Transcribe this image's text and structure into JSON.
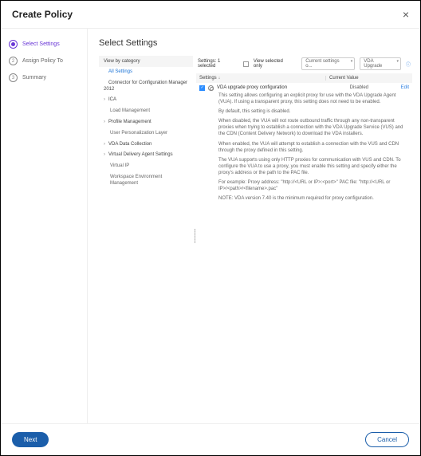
{
  "header": {
    "title": "Create Policy"
  },
  "steps": [
    {
      "label": "Select Settings"
    },
    {
      "label": "Assign Policy To"
    },
    {
      "label": "Summary"
    }
  ],
  "panel": {
    "title": "Select Settings"
  },
  "categories": {
    "header": "View by category",
    "items": [
      {
        "label": "All Settings"
      },
      {
        "label": "Connector for Configuration Manager 2012"
      },
      {
        "label": "ICA"
      },
      {
        "label": "Load Management"
      },
      {
        "label": "Profile Management"
      },
      {
        "label": "User Personalization Layer"
      },
      {
        "label": "VDA Data Collection"
      },
      {
        "label": "Virtual Delivery Agent Settings"
      },
      {
        "label": "Virtual IP"
      },
      {
        "label": "Workspace Environment Management"
      }
    ]
  },
  "toolbar": {
    "selected_text": "Settings: 1 selected",
    "view_selected_label": "View selected only",
    "version_filter": "Current settings o...",
    "vda_filter": "VDA Upgrade"
  },
  "table": {
    "col_settings": "Settings",
    "col_value": "Current Value",
    "rows": [
      {
        "name": "VDA upgrade proxy configuration",
        "value": "Disabled",
        "edit_label": "Edit",
        "desc": [
          "This setting allows configuring an explicit proxy for use with the VDA Upgrade Agent (VUA). If using a transparent proxy, this setting does not need to be enabled.",
          "By default, this setting is disabled.",
          "When disabled, the VUA will not route outbound traffic through any non-transparent proxies when trying to establish a connection with the VDA Upgrade Service (VUS) and the CDN (Content Delivery Network) to download the VDA installers.",
          "When enabled, the VUA will attempt to establish a connection with the VUS and CDN through the proxy defined in this setting.",
          "The VUA supports using only HTTP proxies for communication with VUS and CDN. To configure the VUA to use a proxy, you must enable this setting and specify either the proxy's address or the path to the PAC file.",
          "For example:\nProxy address: \"http://<URL or IP>:<port>\"\nPAC file: \"http://<URL or IP>/<path>/<filename>.pac\"",
          "NOTE: VDA version 7.40 is the minimum required for proxy configuration."
        ]
      }
    ]
  },
  "footer": {
    "next": "Next",
    "cancel": "Cancel"
  }
}
